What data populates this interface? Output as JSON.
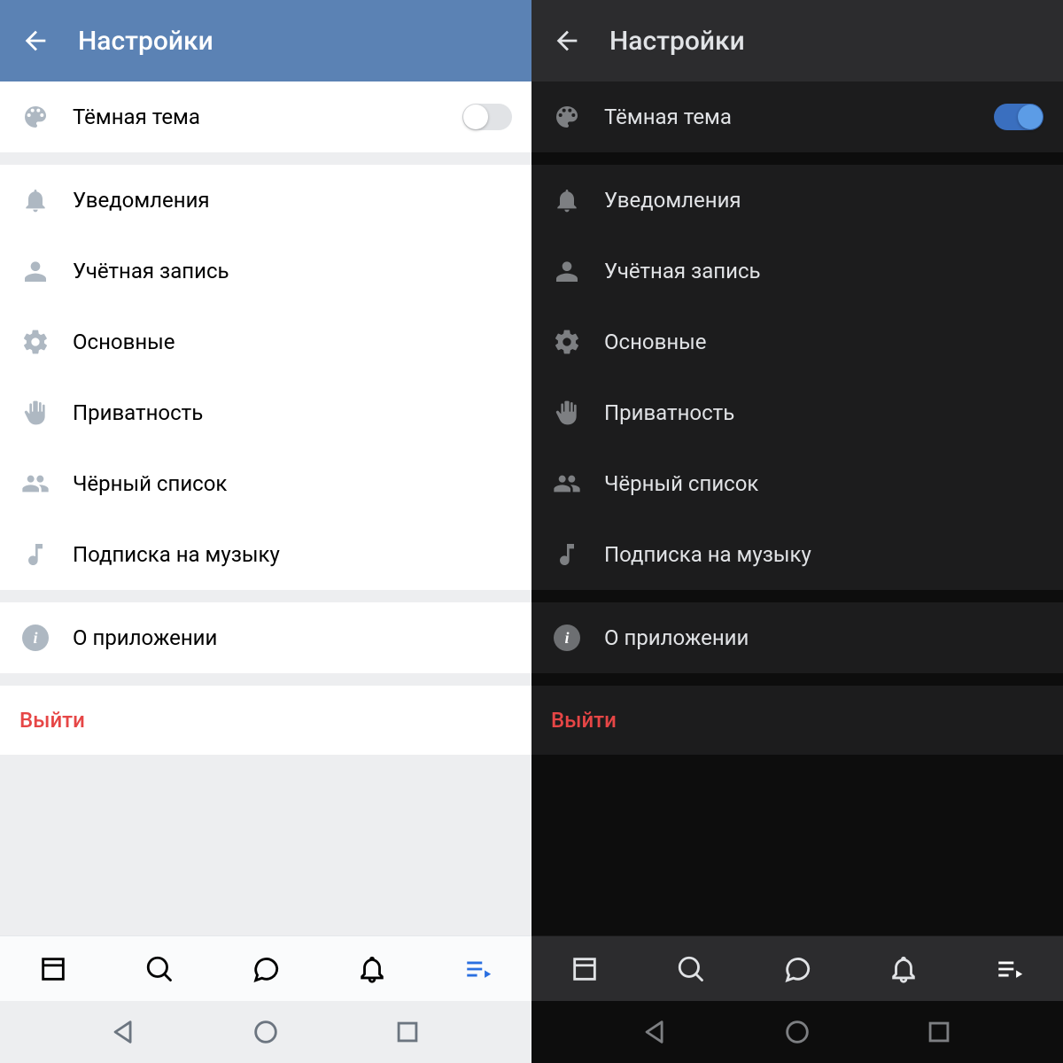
{
  "colors": {
    "light_header": "#5b82b4",
    "dark_header": "#2c2c2e",
    "accent_blue": "#5c9ce6",
    "logout_red": "#e64646"
  },
  "panels": [
    {
      "theme": "light",
      "title": "Настройки",
      "dark_theme_row": {
        "label": "Тёмная тема",
        "enabled": false
      },
      "items": [
        {
          "icon": "bell",
          "label": "Уведомления"
        },
        {
          "icon": "person",
          "label": "Учётная запись"
        },
        {
          "icon": "gear",
          "label": "Основные"
        },
        {
          "icon": "hand",
          "label": "Приватность"
        },
        {
          "icon": "people",
          "label": "Чёрный список"
        },
        {
          "icon": "music",
          "label": "Подписка на музыку"
        }
      ],
      "about": {
        "label": "О приложении"
      },
      "logout": "Выйти"
    },
    {
      "theme": "dark",
      "title": "Настройки",
      "dark_theme_row": {
        "label": "Тёмная тема",
        "enabled": true
      },
      "items": [
        {
          "icon": "bell",
          "label": "Уведомления"
        },
        {
          "icon": "person",
          "label": "Учётная запись"
        },
        {
          "icon": "gear",
          "label": "Основные"
        },
        {
          "icon": "hand",
          "label": "Приватность"
        },
        {
          "icon": "people",
          "label": "Чёрный список"
        },
        {
          "icon": "music",
          "label": "Подписка на музыку"
        }
      ],
      "about": {
        "label": "О приложении"
      },
      "logout": "Выйти"
    }
  ],
  "bottom_tabs": [
    {
      "icon": "feed",
      "active": false
    },
    {
      "icon": "search",
      "active": false
    },
    {
      "icon": "chat",
      "active": false
    },
    {
      "icon": "bell",
      "active": false
    },
    {
      "icon": "menu-play",
      "active": true
    }
  ]
}
